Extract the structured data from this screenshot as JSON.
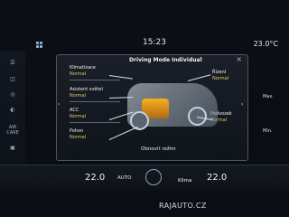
{
  "status": {
    "time": "15:23",
    "outside_temp": "23.0°C"
  },
  "left_rail": {
    "items": [
      "AIR CARE"
    ]
  },
  "dialog": {
    "title": "Driving Mode Individual",
    "left": [
      {
        "label": "Klimatizace",
        "value": "Normal"
      },
      {
        "label": "Asistent světel",
        "value": "Normal"
      },
      {
        "label": "ACC",
        "value": "Normal"
      },
      {
        "label": "Pohon",
        "value": "Normal"
      }
    ],
    "right": [
      {
        "label": "Řízení",
        "value": "Normal"
      },
      {
        "label": "Podvozek",
        "value": "Normal"
      }
    ],
    "footer": "Obnovit režim"
  },
  "scale": {
    "top": "Max.",
    "bottom": "Min."
  },
  "bottom": {
    "left_temp": "22.0",
    "auto": "AUTO",
    "klima": "Klima",
    "right_temp": "22.0"
  },
  "watermark": "RAJAUTO.CZ"
}
